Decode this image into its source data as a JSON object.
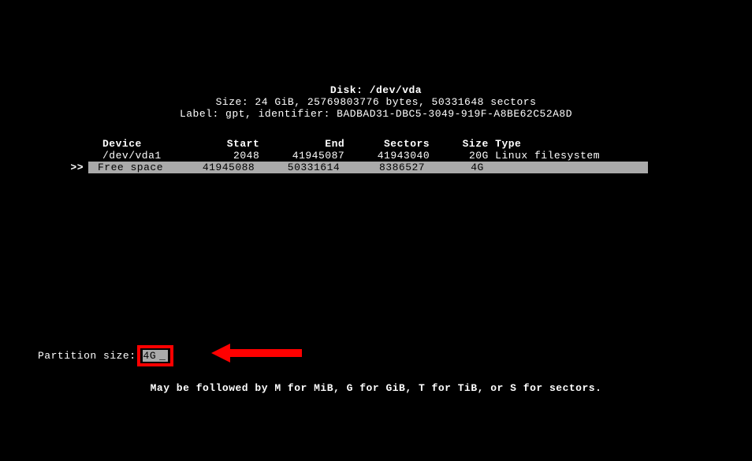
{
  "header": {
    "disk_label": "Disk: /dev/vda",
    "size_line": "Size: 24 GiB, 25769803776 bytes, 50331648 sectors",
    "label_line": "Label: gpt, identifier: BADBAD31-DBC5-3049-919F-A8BE62C52A8D"
  },
  "table": {
    "headers": {
      "device": "Device",
      "start": "Start",
      "end": "End",
      "sectors": "Sectors",
      "size": "Size",
      "type": "Type"
    },
    "rows": [
      {
        "device": "/dev/vda1",
        "start": "2048",
        "end": "41945087",
        "sectors": "41943040",
        "size": "20G",
        "type": "Linux filesystem",
        "selected": false
      },
      {
        "device": "Free space",
        "start": "41945088",
        "end": "50331614",
        "sectors": "8386527",
        "size": "4G",
        "type": "",
        "selected": true
      }
    ],
    "selector": ">>"
  },
  "prompt": {
    "label": "Partition size:",
    "value": "4G",
    "cursor": "_"
  },
  "hint": "May be followed by M for MiB, G for GiB, T for TiB, or S for sectors.",
  "annotation": {
    "arrow_color": "#ff0000"
  }
}
